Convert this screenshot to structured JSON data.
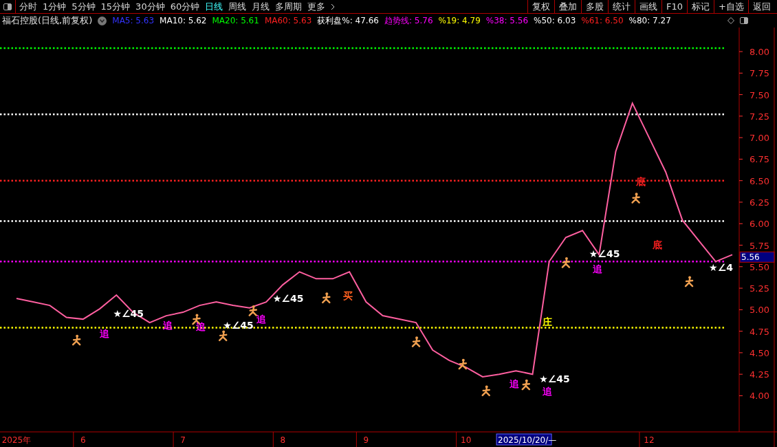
{
  "toolbar": {
    "periods": [
      {
        "label": "分时",
        "selected": false
      },
      {
        "label": "1分钟",
        "selected": false
      },
      {
        "label": "5分钟",
        "selected": false
      },
      {
        "label": "15分钟",
        "selected": false
      },
      {
        "label": "30分钟",
        "selected": false
      },
      {
        "label": "60分钟",
        "selected": false
      },
      {
        "label": "日线",
        "selected": true
      },
      {
        "label": "周线",
        "selected": false
      },
      {
        "label": "月线",
        "selected": false
      },
      {
        "label": "多周期",
        "selected": false
      },
      {
        "label": "更多",
        "selected": false
      }
    ],
    "buttons": [
      "复权",
      "叠加",
      "多股",
      "统计",
      "画线",
      "F10",
      "标记",
      "+自选",
      "返回"
    ]
  },
  "legend": {
    "title": "福石控股(日线,前复权)",
    "indicators": [
      {
        "label": "MA5: 5.63",
        "color": "#3333ff"
      },
      {
        "label": "MA10: 5.62",
        "color": "#ffffff"
      },
      {
        "label": "MA20: 5.61",
        "color": "#00ff00"
      },
      {
        "label": "MA60: 5.63",
        "color": "#ff2020"
      },
      {
        "label": "获利盘%: 47.66",
        "color": "#ffffff"
      },
      {
        "label": "趋势线: 5.76",
        "color": "#ff00ff"
      },
      {
        "label": "%19: 4.79",
        "color": "#ffff00"
      },
      {
        "label": "%38: 5.56",
        "color": "#ff00ff"
      },
      {
        "label": "%50: 6.03",
        "color": "#ffffff"
      },
      {
        "label": "%61: 6.50",
        "color": "#ff2020"
      },
      {
        "label": "%80: 7.27",
        "color": "#ffffff"
      }
    ]
  },
  "chart": {
    "chart_data": {
      "type": "line",
      "ylim": [
        3.58,
        8.28
      ],
      "categories": [
        "2025年",
        null,
        null,
        null,
        "6",
        null,
        null,
        null,
        null,
        null,
        "7",
        null,
        null,
        null,
        null,
        null,
        "8",
        null,
        null,
        null,
        null,
        "9",
        null,
        null,
        null,
        null,
        null,
        "10",
        null,
        null,
        null,
        null,
        null,
        null,
        null,
        null,
        null,
        null,
        "12",
        null,
        null,
        null,
        null,
        null
      ],
      "series": [
        {
          "color": "#ff5fa0",
          "values": [
            5.13,
            5.09,
            5.05,
            4.91,
            4.89,
            5.01,
            5.17,
            4.97,
            4.85,
            4.93,
            4.97,
            5.05,
            5.09,
            5.05,
            5.02,
            5.09,
            5.29,
            5.44,
            5.36,
            5.36,
            5.44,
            5.09,
            4.93,
            4.89,
            4.85,
            4.53,
            4.41,
            4.33,
            4.22,
            4.25,
            4.29,
            4.25,
            5.56,
            5.84,
            5.92,
            5.64,
            6.84,
            7.4,
            7.0,
            6.6,
            6.04,
            5.8,
            5.56,
            5.64
          ]
        }
      ],
      "yticks": [
        {
          "value": 4,
          "label": "4.00"
        },
        {
          "value": 4.25,
          "label": "4.25"
        },
        {
          "value": 4.5,
          "label": "4.50"
        },
        {
          "value": 4.75,
          "label": "4.75"
        },
        {
          "value": 5,
          "label": "5.00"
        },
        {
          "value": 5.25,
          "label": "5.25"
        },
        {
          "value": 5.5,
          "label": "5.50"
        },
        {
          "value": 5.75,
          "label": "5.75"
        },
        {
          "value": 6,
          "label": "6.00"
        },
        {
          "value": 6.25,
          "label": "6.25"
        },
        {
          "value": 6.5,
          "label": "6.50"
        },
        {
          "value": 6.75,
          "label": "6.75"
        },
        {
          "value": 7,
          "label": "7.00"
        },
        {
          "value": 7.25,
          "label": "7.25"
        },
        {
          "value": 7.5,
          "label": "7.50"
        },
        {
          "value": 7.75,
          "label": "7.75"
        },
        {
          "value": 8,
          "label": "8.00"
        }
      ],
      "ref_lines": [
        {
          "axis": "y",
          "value": 8.04,
          "color": "#00ff00"
        },
        {
          "axis": "y",
          "value": 7.27,
          "color": "#ffffff"
        },
        {
          "axis": "y",
          "value": 6.5,
          "color": "#ff2020"
        },
        {
          "axis": "y",
          "value": 6.03,
          "color": "#ffffff"
        },
        {
          "axis": "y",
          "value": 5.56,
          "color": "#ff00ff"
        },
        {
          "axis": "y",
          "value": 4.79,
          "color": "#ffff00"
        }
      ]
    },
    "signals": [
      {
        "text": "追",
        "color": "#ff00ff"
      },
      {
        "text": "追",
        "color": "#ff00ff"
      },
      {
        "text": "追",
        "color": "#ff00ff"
      },
      {
        "text": "追",
        "color": "#ff00ff"
      },
      {
        "text": "追",
        "color": "#ff00ff"
      },
      {
        "text": "追",
        "color": "#ff00ff"
      },
      {
        "text": "追",
        "color": "#ff00ff"
      },
      {
        "text": "★∠45",
        "color": "#ffffff"
      },
      {
        "text": "★∠45",
        "color": "#ffffff"
      },
      {
        "text": "★∠45",
        "color": "#ffffff"
      },
      {
        "text": "★∠45",
        "color": "#ffffff"
      },
      {
        "text": "★∠45",
        "color": "#ffffff"
      },
      {
        "text": "★∠4",
        "color": "#ffffff"
      },
      {
        "text": "庄",
        "color": "#ffff00"
      },
      {
        "text": "底",
        "color": "#ff2020"
      },
      {
        "text": "底",
        "color": "#ff2020"
      },
      {
        "text": "买",
        "color": "#ff6020"
      }
    ],
    "price_tag": "5.56",
    "cursor": "2025/10/20/—"
  }
}
